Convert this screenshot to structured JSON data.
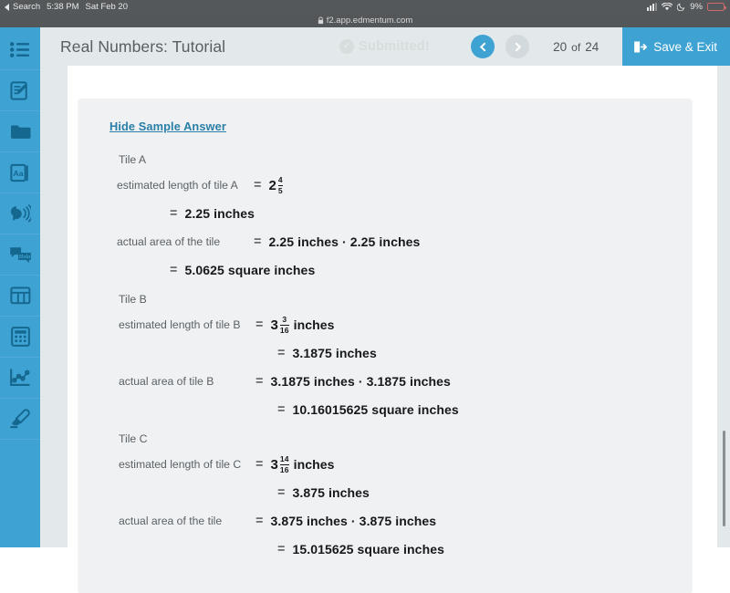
{
  "status_bar": {
    "back_label": "Search",
    "time": "5:38 PM",
    "date": "Sat Feb 20",
    "battery_percent": "9%",
    "battery_level": 9,
    "icons": [
      "signal-bars-icon",
      "wifi-icon",
      "moon-icon",
      "battery-icon"
    ]
  },
  "browser": {
    "lock_glyph": "A",
    "url": "f2.app.edmentum.com"
  },
  "sidebar": {
    "items": [
      {
        "name": "menu-list-icon"
      },
      {
        "name": "notepad-icon"
      },
      {
        "name": "folder-icon"
      },
      {
        "name": "dictionary-icon",
        "label": "Aa"
      },
      {
        "name": "text-to-speech-icon"
      },
      {
        "name": "translate-icon",
        "label": "Hola"
      },
      {
        "name": "reference-book-icon"
      },
      {
        "name": "calculator-icon"
      },
      {
        "name": "graph-chart-icon"
      },
      {
        "name": "highlighter-icon"
      }
    ]
  },
  "header": {
    "title": "Real Numbers: Tutorial",
    "submitted_label": "Submitted!",
    "submitted_check": "✓",
    "page_current": "20",
    "page_of": "of",
    "page_total": "24",
    "save_exit_label": "Save & Exit",
    "accent_color": "#3ea2d3",
    "header_bg": "#e3e8ea"
  },
  "content": {
    "hide_sample_answer": "Hide Sample Answer",
    "tiles": [
      {
        "tile_label": "Tile A",
        "length_label": "estimated length of tile A",
        "length_whole": "2",
        "length_num": "4",
        "length_den": "5",
        "length_unit": "",
        "length_decimal": "2.25 inches",
        "area_label": "actual area of the tile",
        "area_product": "2.25 inches · 2.25 inches",
        "area_result": "5.0625 square inches"
      },
      {
        "tile_label": "Tile B",
        "length_label": "estimated length of tile B",
        "length_whole": "3",
        "length_num": "3",
        "length_den": "16",
        "length_unit": "inches",
        "length_decimal": "3.1875 inches",
        "area_label": "actual area of tile B",
        "area_product": "3.1875 inches · 3.1875 inches",
        "area_result": "10.16015625 square inches"
      },
      {
        "tile_label": "Tile C",
        "length_label": "estimated length of tile C",
        "length_whole": "3",
        "length_num": "14",
        "length_den": "16",
        "length_unit": "inches",
        "length_decimal": "3.875 inches",
        "area_label": "actual area of the tile",
        "area_product": "3.875 inches · 3.875 inches",
        "area_result": "15.015625 square inches"
      }
    ],
    "equals": "="
  }
}
